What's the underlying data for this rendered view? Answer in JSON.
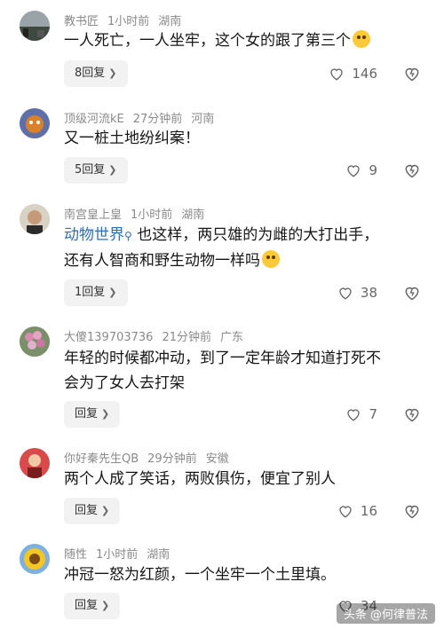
{
  "comments": [
    {
      "username": "教书匠",
      "time": "1小时前",
      "location": "湖南",
      "text": "一人死亡，一人坐牢，这个女的跟了第三个",
      "reply_label": "8回复",
      "likes": "146"
    },
    {
      "username": "顶级河流kE",
      "time": "27分钟前",
      "location": "河南",
      "text": "又一桩土地纷纠案！",
      "reply_label": "5回复",
      "likes": "9"
    },
    {
      "username": "南宫皇上皇",
      "time": "1小时前",
      "location": "湖南",
      "mention": "动物世界",
      "text": "也这样，两只雄的为雌的大打出手，还有人智商和野生动物一样吗",
      "reply_label": "1回复",
      "likes": "38"
    },
    {
      "username": "大傻139703736",
      "time": "21分钟前",
      "location": "广东",
      "text": "年轻的时候都冲动，到了一定年龄才知道打死不会为了女人去打架",
      "reply_label": "回复",
      "likes": "7"
    },
    {
      "username": "你好秦先生QB",
      "time": "29分钟前",
      "location": "安徽",
      "text": "两个人成了笑话，两败俱伤，便宜了别人",
      "reply_label": "回复",
      "likes": "16"
    },
    {
      "username": "随性",
      "time": "1小时前",
      "location": "湖南",
      "text": "冲冠一怒为红颜，一个坐牢一个土里填。",
      "reply_label": "回复",
      "likes": "34"
    }
  ],
  "watermark": "头条 @何律普法",
  "icons": {
    "like": "heart-icon",
    "dislike": "dislike-icon",
    "chevron": "chevron-right-icon",
    "search_mention": "search-icon",
    "emoji": "laughing-emoji-icon"
  },
  "colors": {
    "mention": "#2f6fb5",
    "meta": "#8a8a8a",
    "reply_bg": "#f2f2f2"
  }
}
